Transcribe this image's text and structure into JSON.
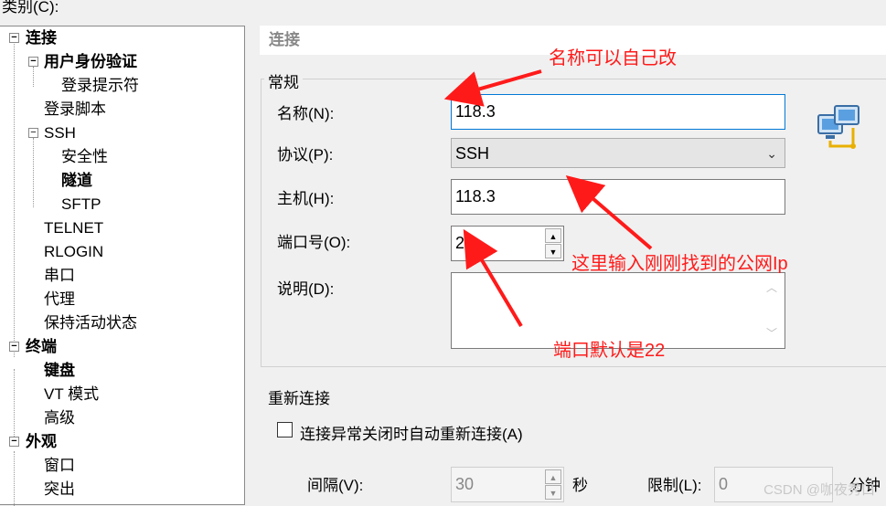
{
  "category_label": "类别(C):",
  "tree": {
    "connection": "连接",
    "auth": "用户身份验证",
    "login_prompts": "登录提示符",
    "login_script": "登录脚本",
    "ssh": "SSH",
    "security": "安全性",
    "tunnel": "隧道",
    "sftp": "SFTP",
    "telnet": "TELNET",
    "rlogin": "RLOGIN",
    "serial": "串口",
    "proxy": "代理",
    "keepalive": "保持活动状态",
    "terminal": "终端",
    "keyboard": "键盘",
    "vt_mode": "VT 模式",
    "advanced": "高级",
    "appearance": "外观",
    "window": "窗口",
    "highlight": "突出"
  },
  "panel_header": "连接",
  "general": {
    "title": "常规",
    "name_label": "名称(N):",
    "name_value": "118.3",
    "protocol_label": "协议(P):",
    "protocol_value": "SSH",
    "host_label": "主机(H):",
    "host_value": "118.3",
    "port_label": "端口号(O):",
    "port_value": "22",
    "desc_label": "说明(D):",
    "desc_value": ""
  },
  "reconnect": {
    "title": "重新连接",
    "checkbox_label": "连接异常关闭时自动重新连接(A)",
    "interval_label": "间隔(V):",
    "interval_value": "30",
    "interval_unit": "秒",
    "limit_label": "限制(L):",
    "limit_value": "0",
    "limit_unit": "分钟"
  },
  "annotations": {
    "rename_note": "名称可以自己改",
    "host_note": "这里输入刚刚找到的公网Ip",
    "port_note": "端口默认是22"
  },
  "watermark": "CSDN @咖夜秀口",
  "colors": {
    "annotation": "#ff1a1a",
    "focus": "#0078d7"
  }
}
